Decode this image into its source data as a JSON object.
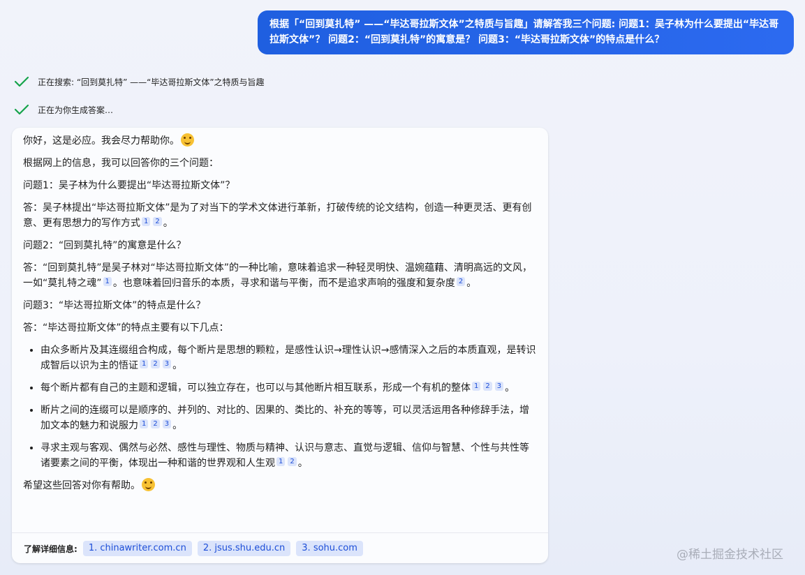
{
  "user_message": "根据「“回到莫扎特” ——“毕达哥拉斯文体”之特质与旨趣」请解答我三个问题: 问题1：吴子林为什么要提出“毕达哥拉斯文体”？ 问题2：“回到莫扎特”的寓意是？ 问题3：“毕达哥拉斯文体”的特点是什么？",
  "status": {
    "searching": "正在搜索: “回到莫扎特” ——“毕达哥拉斯文体”之特质与旨趣",
    "generating": "正在为你生成答案…"
  },
  "answer": {
    "greeting": "你好，这是必应。我会尽力帮助你。",
    "intro": "根据网上的信息，我可以回答你的三个问题：",
    "q1": "问题1：吴子林为什么要提出“毕达哥拉斯文体”？",
    "a1": "答：吴子林提出“毕达哥拉斯文体”是为了对当下的学术文体进行革新，打破传统的论文结构，创造一种更灵活、更有创意、更有思想力的写作方式",
    "q2": "问题2：“回到莫扎特”的寓意是什么？",
    "a2_part1": "答：“回到莫扎特”是吴子林对“毕达哥拉斯文体”的一种比喻，意味着追求一种轻灵明快、温婉蕴藉、清明高远的文风，一如“莫扎特之魂”",
    "a2_part2": "。也意味着回归音乐的本质，寻求和谐与平衡，而不是追求声响的强度和复杂度",
    "q3": "问题3：“毕达哥拉斯文体”的特点是什么？",
    "a3_intro": "答：“毕达哥拉斯文体”的特点主要有以下几点：",
    "points": [
      "由众多断片及其连缀组合构成，每个断片是思想的颗粒，是感性认识→理性认识→感情深入之后的本质直观，是转识成智后以识为主的悟证",
      "每个断片都有自己的主题和逻辑，可以独立存在，也可以与其他断片相互联系，形成一个有机的整体",
      "断片之间的连缀可以是顺序的、并列的、对比的、因果的、类比的、补充的等等，可以灵活运用各种修辞手法，增加文本的魅力和说服力",
      "寻求主观与客观、偶然与必然、感性与理性、物质与精神、认识与意志、直觉与逻辑、信仰与智慧、个性与共性等诸要素之间的平衡，体现出一种和谐的世界观和人生观"
    ],
    "closing": "希望这些回答对你有帮助。",
    "period": "。",
    "cite_labels": [
      "1",
      "2",
      "3"
    ]
  },
  "learn_more": {
    "label": "了解详细信息:",
    "links": [
      "1. chinawriter.com.cn",
      "2. jsus.shu.edu.cn",
      "3. sohu.com"
    ]
  },
  "watermark": "@稀土掘金技术社区",
  "colors": {
    "accent": "#2563eb",
    "check": "#15a34a",
    "cite_bg": "#dbe4fb"
  }
}
